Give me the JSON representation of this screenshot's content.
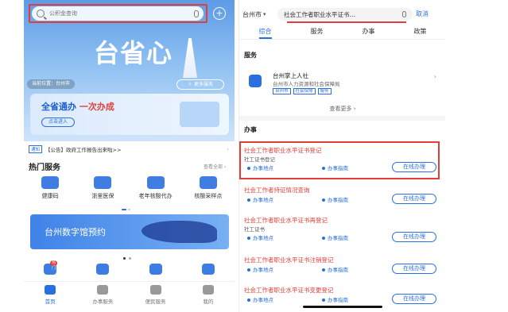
{
  "left": {
    "search": {
      "placeholder": "公积金查询"
    },
    "brand": "台省心",
    "location_pill": "当前位置：台州市",
    "activity_pill": "＋ 更多服务",
    "banner": {
      "title_a": "全省通办",
      "title_b": "一次办成",
      "button": "点击进入"
    },
    "notice": {
      "tag": "通知",
      "text": "【公告】政府工作报告出来啦>>",
      "more": "›"
    },
    "hot": {
      "title": "热门服务",
      "all": "查看全部 ›"
    },
    "services": [
      {
        "icon": "health-code-icon",
        "label": "健康码"
      },
      {
        "icon": "medical-insurance-icon",
        "label": "浙里医保"
      },
      {
        "icon": "elderly-card-icon",
        "label": "老年核酸代办"
      },
      {
        "icon": "vaccine-location-icon",
        "label": "核酸采样点"
      }
    ],
    "promo": "台州数字馆预约",
    "quick_badge": "热门",
    "tabs": [
      {
        "label": "首页",
        "active": true
      },
      {
        "label": "办事服务",
        "active": false
      },
      {
        "label": "便民服务",
        "active": false
      },
      {
        "label": "我的",
        "active": false
      }
    ]
  },
  "right": {
    "city": "台州市",
    "search_value": "社会工作者职业水平证书…",
    "cancel": "取消",
    "tabs": [
      {
        "label": "综合",
        "active": true
      },
      {
        "label": "服务",
        "active": false
      },
      {
        "label": "办事",
        "active": false
      },
      {
        "label": "政策",
        "active": false
      }
    ],
    "service_section": "服务",
    "service": {
      "name": "台州掌上人社",
      "dept": "台州市人力资源和社会保障局",
      "tags": [
        "台州市",
        "社会保障",
        "服务"
      ]
    },
    "view_more": "查看更多 ›",
    "affair_section": "办事",
    "items": [
      {
        "title": "社会工作者职业水平证书登记",
        "sub": "社工证书登记",
        "a1": "办事地点",
        "a2": "办事指南",
        "online": "在线办理"
      },
      {
        "title": "社会工作者持证情况查询",
        "sub": "",
        "a1": "办事地点",
        "a2": "办事指南",
        "online": "在线办理"
      },
      {
        "title": "社会工作者职业水平证书再登记",
        "sub": "社工证书",
        "a1": "办事地点",
        "a2": "办事指南",
        "online": "在线办理"
      },
      {
        "title": "社会工作者职业水平证书注销登记",
        "sub": "",
        "a1": "办事地点",
        "a2": "办事指南",
        "online": "在线办理"
      },
      {
        "title": "社会工作者职业水平证书变更登记",
        "sub": "",
        "a1": "办事地点",
        "a2": "办事指南",
        "online": "在线办理"
      }
    ]
  }
}
